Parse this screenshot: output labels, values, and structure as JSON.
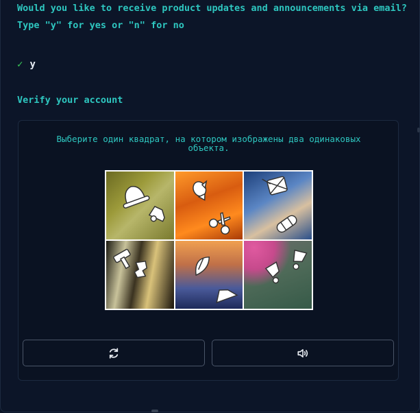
{
  "prompt": {
    "line1": "Would you like to receive product updates and announcements via email?",
    "line2": "Type \"y\" for yes or \"n\" for no"
  },
  "answer": {
    "check": "✓",
    "value": "y"
  },
  "verify_heading": "Verify your account",
  "captcha": {
    "instruction": "Выберите один квадрат, на котором изображены два одинаковых объекта.",
    "tiles": [
      {
        "icons": [
          "hat-icon",
          "shoe-icon"
        ]
      },
      {
        "icons": [
          "bird-icon",
          "scissors-icon"
        ]
      },
      {
        "icons": [
          "drum-icon",
          "bandage-icon"
        ]
      },
      {
        "icons": [
          "hammer-icon",
          "puzzle-icon"
        ]
      },
      {
        "icons": [
          "feather-icon",
          "shoe-icon"
        ]
      },
      {
        "icons": [
          "footprint-icon",
          "footprint-icon"
        ]
      }
    ],
    "reload_icon": "reload-icon",
    "audio_icon": "audio-icon"
  }
}
